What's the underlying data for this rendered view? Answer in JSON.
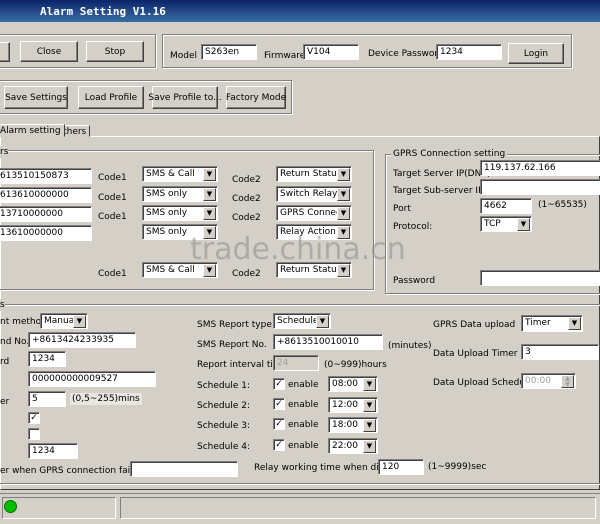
{
  "window": {
    "title": "Alarm Setting V1.16"
  },
  "topbar": {
    "close_label": "Close",
    "stop_label": "Stop"
  },
  "device": {
    "model_label": "Model",
    "model_value": "S263en",
    "firmware_label": "Firmware",
    "firmware_value": "V104",
    "password_label": "Device Password",
    "password_value": "1234",
    "login_label": "Login"
  },
  "actions": {
    "save_settings": "Save Settings",
    "load_profile": "Load Profile",
    "save_profile": "Save Profile to...",
    "factory_mode": "Factory Mode"
  },
  "tabs": [
    {
      "label": "Alarm setting"
    },
    {
      "label": "Others"
    }
  ],
  "phone_group": {
    "title": "rs",
    "numbers": [
      "613510150873",
      "613610000000",
      "13710000000",
      "13610000000"
    ],
    "code1_label": "Code1",
    "code1_values": [
      "SMS & Call",
      "SMS only",
      "SMS only",
      "SMS only",
      "SMS & Call"
    ],
    "code2_label": "Code2",
    "code2_values": [
      "Return Status S",
      "Switch Relay",
      "GPRS Connect",
      "Relay Action",
      "Return Status S"
    ]
  },
  "gprs": {
    "title": "GPRS Connection setting",
    "server_label": "Target Server IP(DNS)",
    "server_value": "119.137.62.166",
    "subserver_label": "Target Sub-server IP(D",
    "subserver_value": "",
    "port_label": "Port",
    "port_value": "4662",
    "port_range": "(1~65535)",
    "protocol_label": "Protocol:",
    "protocol_value": "TCP",
    "password_label": "Password",
    "password_value": ""
  },
  "report": {
    "group_title": "s",
    "method_label": "nt method",
    "method_value": "Manual",
    "phone_label": "nd No.",
    "phone_value": "+8613424233935",
    "pw_label": "rd",
    "pw_value": "1234",
    "id_value": "000000000009527",
    "interval_label": "er",
    "interval_value": "5",
    "interval_range": "(0,5~255)mins",
    "extra_value": "1234",
    "failure_label": "er when GPRS connection failure",
    "failure_value": ""
  },
  "sms_report": {
    "type_label": "SMS Report type",
    "type_value": "Schedule",
    "no_label": "SMS Report No.",
    "no_value": "+8613510010010",
    "no_unit": "(minutes)",
    "interval_label": "Report interval time",
    "interval_value": "24",
    "interval_range": "(0~999)hours",
    "schedules": [
      {
        "label": "Schedule 1:",
        "enable": "enable",
        "time": "08:00"
      },
      {
        "label": "Schedule 2:",
        "enable": "enable",
        "time": "12:00"
      },
      {
        "label": "Schedule 3:",
        "enable": "enable",
        "time": "18:00"
      },
      {
        "label": "Schedule 4:",
        "enable": "enable",
        "time": "22:00"
      }
    ],
    "relay_label": "Relay working time when dial-in",
    "relay_value": "120",
    "relay_range": "(1~9999)sec"
  },
  "gprs_upload": {
    "upload_label": "GPRS Data upload",
    "upload_value": "Timer",
    "timer_label": "Data Upload Timer",
    "timer_value": "3",
    "schedule_label": "Data Upload Schedule",
    "schedule_value": "00:00"
  },
  "watermark": "trade.china.cn",
  "colors": {
    "title_bar": "#0a246a",
    "status_led": "#00c000",
    "face": "#d4d0c8"
  }
}
